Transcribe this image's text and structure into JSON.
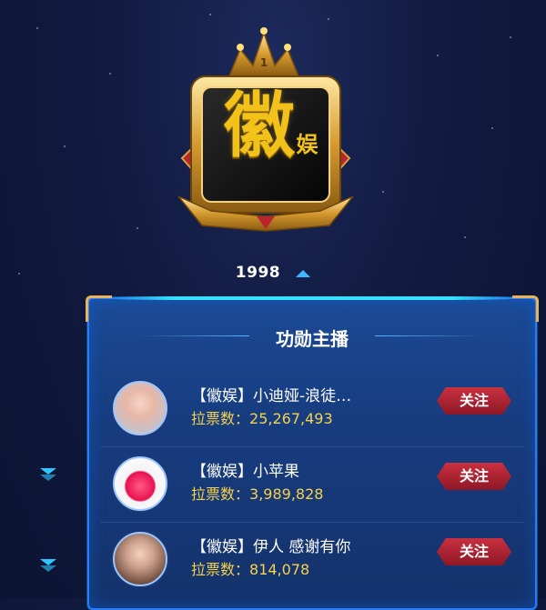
{
  "badge": {
    "rank": "1",
    "main_char": "徽",
    "sub_text": "娱"
  },
  "fans": {
    "count": "1998"
  },
  "panel": {
    "title": "功勋主播",
    "rows": [
      {
        "name": "【徽娱】小迪娅-浪徒…",
        "votes_label": "拉票数：",
        "votes": "25,267,493",
        "follow_label": "关注",
        "avatar": "avatar-woman"
      },
      {
        "name": "【徽娱】小苹果",
        "votes_label": "拉票数：",
        "votes": "3,989,828",
        "follow_label": "关注",
        "avatar": "avatar-apple"
      },
      {
        "name": "【徽娱】伊人 感谢有你",
        "votes_label": "拉票数：",
        "votes": "814,078",
        "follow_label": "关注",
        "avatar": "avatar-woman"
      }
    ]
  },
  "colors": {
    "gold": "#f2c21b",
    "accent_blue": "#2ec6ff",
    "follow_red": "#c8303f"
  }
}
